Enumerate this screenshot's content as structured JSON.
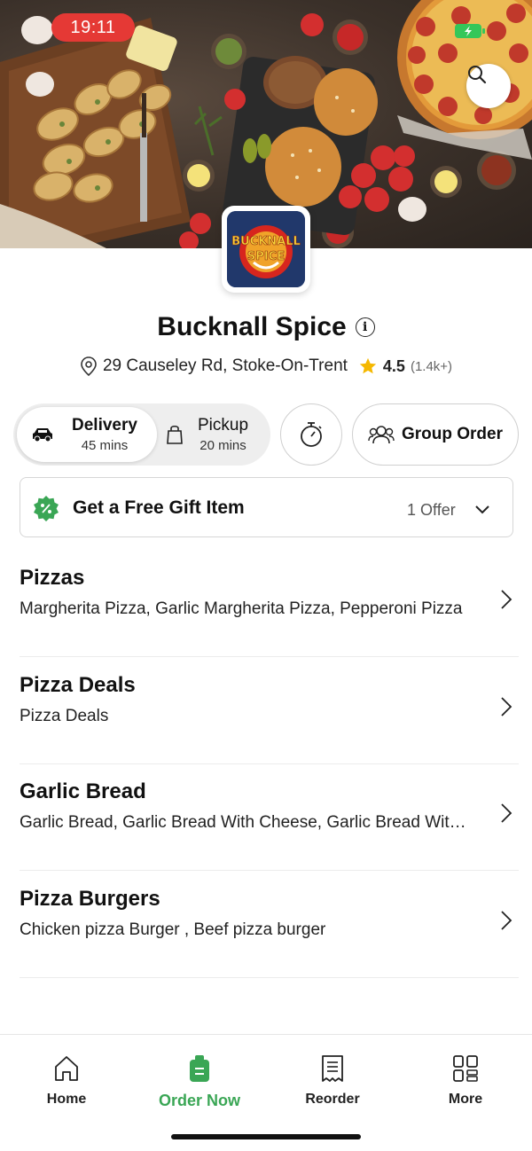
{
  "status_bar": {
    "time": "19:11"
  },
  "restaurant": {
    "name": "Bucknall Spice",
    "logo_text": "BUCKNALL SPICE",
    "address": "29 Causeley Rd, Stoke-On-Trent",
    "rating": "4.5",
    "rating_count": "(1.4k+)"
  },
  "order_modes": {
    "delivery": {
      "label": "Delivery",
      "time": "45 mins",
      "selected": true
    },
    "pickup": {
      "label": "Pickup",
      "time": "20 mins",
      "selected": false
    }
  },
  "group_order_label": "Group Order",
  "offer": {
    "title": "Get a Free Gift Item",
    "count": "1 Offer"
  },
  "categories": [
    {
      "name": "Pizzas",
      "items": "Margherita Pizza, Garlic Margherita Pizza, Pepperoni Pizza"
    },
    {
      "name": "Pizza Deals",
      "items": "Pizza Deals"
    },
    {
      "name": "Garlic Bread",
      "items": "Garlic Bread, Garlic Bread With Cheese, Garlic Bread With Cheese & Mushroom"
    },
    {
      "name": "Pizza Burgers",
      "items": "Chicken pizza Burger , Beef pizza burger"
    }
  ],
  "bottom_nav": [
    {
      "label": "Home",
      "icon": "home-icon",
      "active": false
    },
    {
      "label": "Order Now",
      "icon": "order-bag-icon",
      "active": true
    },
    {
      "label": "Reorder",
      "icon": "receipt-icon",
      "active": false
    },
    {
      "label": "More",
      "icon": "grid-icon",
      "active": false
    }
  ],
  "colors": {
    "accent_green": "#3aa655",
    "status_red": "#e53935",
    "star": "#f5b800",
    "logo_navy": "#21386b"
  }
}
